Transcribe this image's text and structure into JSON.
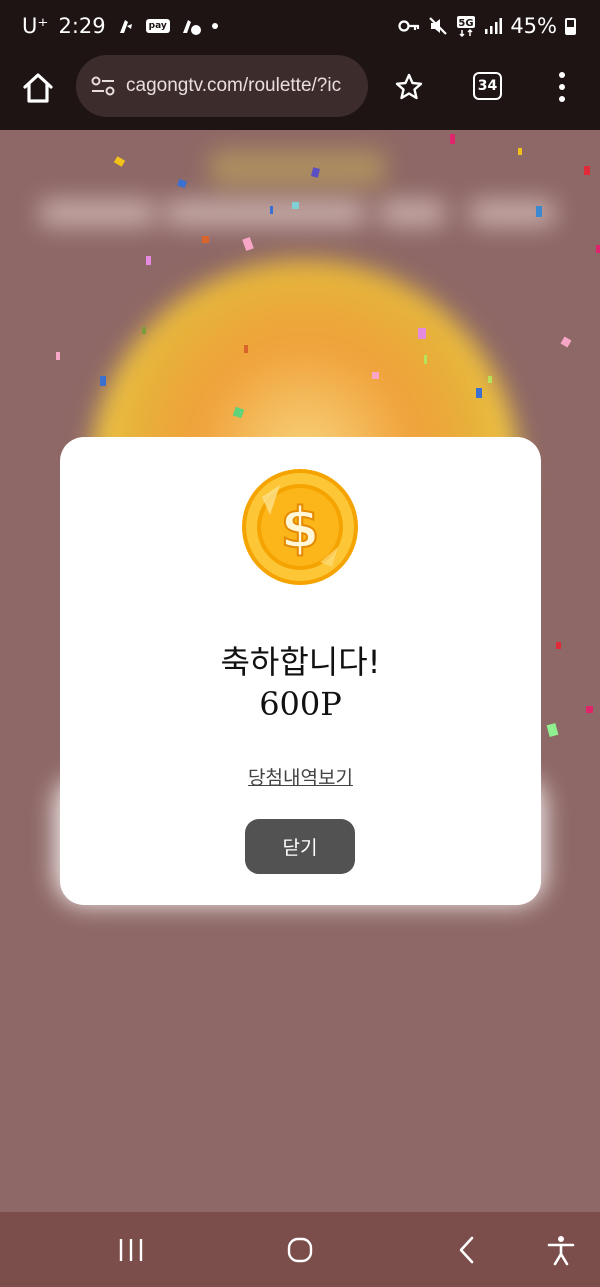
{
  "status_bar": {
    "carrier": "U⁺",
    "time": "2:29",
    "pay_label": "pay",
    "network": "5G",
    "battery": "45%"
  },
  "browser": {
    "url": "cagongtv.com/roulette/?ic",
    "tab_count": "34"
  },
  "modal": {
    "title": "축하합니다!",
    "points": "600P",
    "history_link": "당첨내역보기",
    "close_label": "닫기"
  },
  "colors": {
    "background": "#8e6866",
    "modal": "#ffffff",
    "close_button": "#525252",
    "nav_bar": "#7b4d4b",
    "top_bar": "#1e1414"
  }
}
